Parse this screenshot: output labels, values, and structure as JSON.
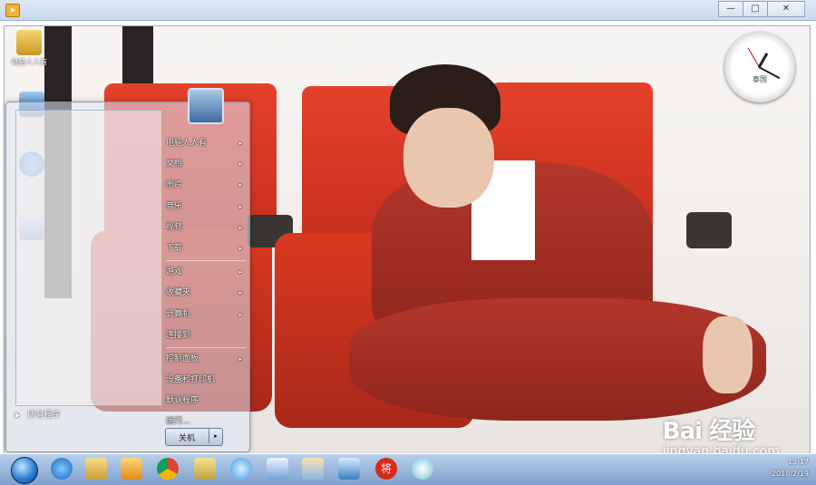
{
  "window": {
    "minimize": "—",
    "maximize": "□",
    "close": "✕"
  },
  "desktop": {
    "icons": [
      {
        "label": "电脑人人有"
      },
      {
        "label": ""
      },
      {
        "label": ""
      },
      {
        "label": ""
      }
    ]
  },
  "clock": {
    "label": "泰国"
  },
  "start_menu": {
    "items": [
      {
        "label": "电脑人人有",
        "has_sub": "▸"
      },
      {
        "label": "文档",
        "has_sub": "▸"
      },
      {
        "label": "图片",
        "has_sub": "▸"
      },
      {
        "label": "音乐",
        "has_sub": "▸"
      },
      {
        "label": "视频",
        "has_sub": "▸"
      },
      {
        "label": "下载",
        "has_sub": "▸"
      },
      {
        "label": "游戏",
        "has_sub": "▸"
      },
      {
        "label": "收藏夹",
        "has_sub": "▸"
      },
      {
        "label": "计算机",
        "has_sub": "▸"
      },
      {
        "label": "连接到",
        "has_sub": ""
      },
      {
        "label": "控制面板",
        "has_sub": "▸"
      },
      {
        "label": "设备和打印机",
        "has_sub": ""
      },
      {
        "label": "默认程序",
        "has_sub": ""
      },
      {
        "label": "运行...",
        "has_sub": ""
      }
    ],
    "all_programs": "所有程序",
    "shutdown": "关机",
    "shutdown_arrow": "▸"
  },
  "taskbar": {
    "icons": [
      "ie-icon",
      "explorer-icon",
      "media-player-icon",
      "chrome-icon",
      "folder-icon",
      "cloud-icon",
      "document-icon",
      "paint-icon",
      "remote-desktop-icon",
      "chinese-chess-icon",
      "pinwheel-icon"
    ],
    "chess_char": "将",
    "time": "13:17",
    "date": "2018/2/19"
  },
  "watermark": {
    "brand": "Bai 经验",
    "url": "jingyan.baidu.com"
  },
  "colors": {
    "accent": "#d9391f",
    "taskbar": "#8fb0d8"
  }
}
